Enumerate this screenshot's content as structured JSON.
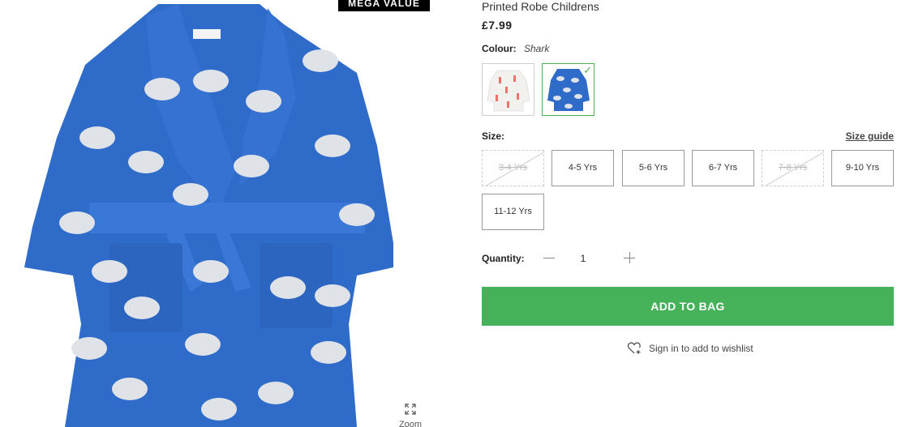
{
  "badge": "MEGA VALUE",
  "zoom_label": "Zoom",
  "product": {
    "title": "Printed Robe Childrens",
    "price": "£7.99"
  },
  "colour": {
    "label": "Colour:",
    "selected": "Shark",
    "swatches": [
      {
        "name": "swatch-flamingo",
        "selected": false
      },
      {
        "name": "swatch-shark",
        "selected": true
      }
    ]
  },
  "size": {
    "label": "Size:",
    "guide_label": "Size guide",
    "options": [
      {
        "label": "3-4 Yrs",
        "available": false
      },
      {
        "label": "4-5 Yrs",
        "available": true
      },
      {
        "label": "5-6 Yrs",
        "available": true
      },
      {
        "label": "6-7 Yrs",
        "available": true
      },
      {
        "label": "7-8 Yrs",
        "available": false
      },
      {
        "label": "9-10 Yrs",
        "available": true
      },
      {
        "label": "11-12 Yrs",
        "available": true
      }
    ]
  },
  "quantity": {
    "label": "Quantity:",
    "value": "1"
  },
  "add_to_bag": "ADD TO BAG",
  "wishlist": "Sign in to add to wishlist",
  "colors": {
    "accent_green": "#45b25a",
    "robe_blue": "#2f6bc9",
    "badge_bg": "#000000"
  }
}
